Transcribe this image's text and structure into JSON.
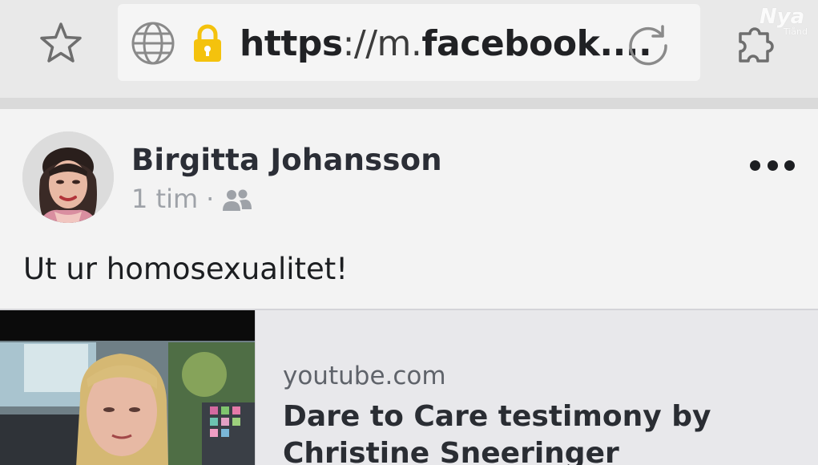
{
  "browser": {
    "url_prefix": "https",
    "url_scheme_sep": "://m.",
    "url_domain": "facebook.",
    "url_ellipsis": "...",
    "watermark_main": "Nya",
    "watermark_sub": "Tiånd"
  },
  "post": {
    "author": "Birgitta Johansson",
    "time": "1 tim",
    "separator": "·",
    "text": "Ut ur homosexualitet!"
  },
  "link_preview": {
    "domain": "youtube.com",
    "title": "Dare to Care testimony by Christine Sneeringer"
  },
  "colors": {
    "toolbar_bg": "#e9e9e9",
    "lock_yellow": "#f4c20d",
    "post_bg": "#f3f3f3",
    "text_dark": "#1c1e21",
    "meta_gray": "#9ea2a8"
  }
}
